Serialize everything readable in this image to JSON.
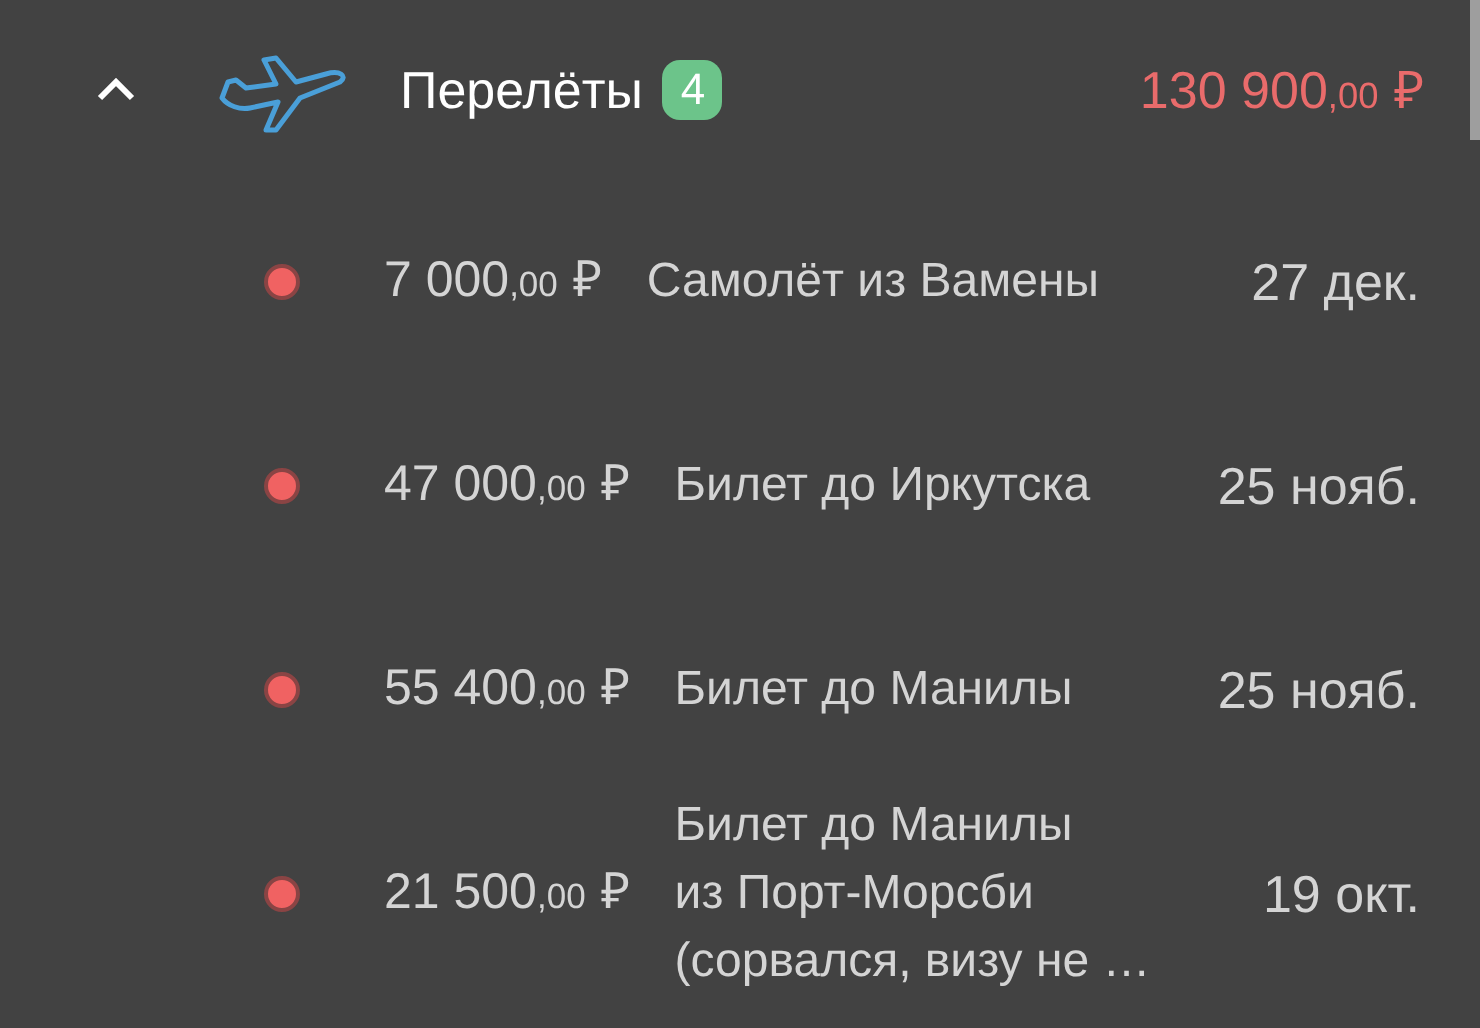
{
  "group": {
    "expanded": true,
    "title": "Перелёты",
    "count": "4",
    "total": {
      "amount": "130 900",
      "cents": ",00",
      "currency": "₽"
    }
  },
  "expenses": [
    {
      "color": "#f06262",
      "amount": "7 000",
      "cents": ",00",
      "currency": "₽",
      "description": "Самолёт из Вамены",
      "date": "27 дек."
    },
    {
      "color": "#f06262",
      "amount": "47 000",
      "cents": ",00",
      "currency": "₽",
      "description": "Билет до Иркутска",
      "date": "25 нояб."
    },
    {
      "color": "#f06262",
      "amount": "55 400",
      "cents": ",00",
      "currency": "₽",
      "description": "Билет до Манилы",
      "date": "25 нояб."
    },
    {
      "color": "#f06262",
      "amount": "21 500",
      "cents": ",00",
      "currency": "₽",
      "description": "Билет до Манилы\nиз Порт-Морсби\n(сорвался, визу не …",
      "date": "19 окт."
    }
  ]
}
